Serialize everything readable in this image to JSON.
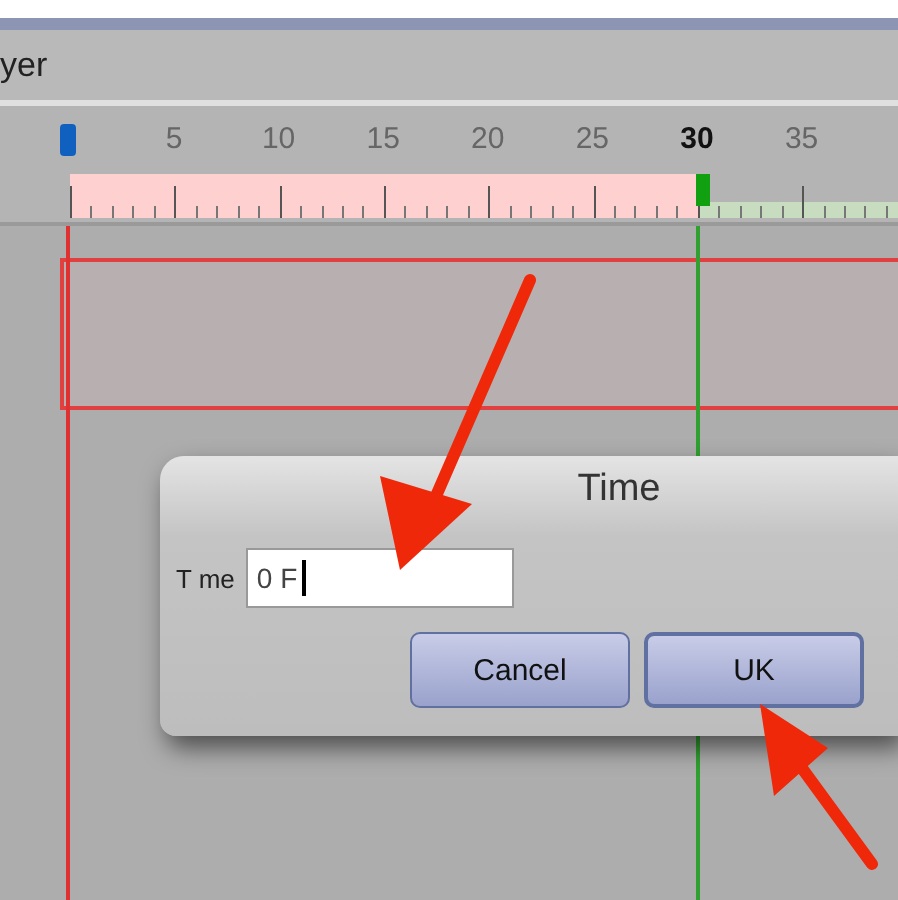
{
  "header": {
    "title": "yer"
  },
  "ruler": {
    "labels": [
      {
        "text": "5",
        "current": false
      },
      {
        "text": "10",
        "current": false
      },
      {
        "text": "15",
        "current": false
      },
      {
        "text": "20",
        "current": false
      },
      {
        "text": "25",
        "current": false
      },
      {
        "text": "30",
        "current": true
      },
      {
        "text": "35",
        "current": false
      }
    ]
  },
  "dialog": {
    "title": "Time",
    "field": {
      "label": "T me",
      "value": "0 F"
    },
    "buttons": [
      {
        "label": "Cancel",
        "kind": "secondary"
      },
      {
        "label": "UK",
        "kind": "default"
      }
    ]
  }
}
